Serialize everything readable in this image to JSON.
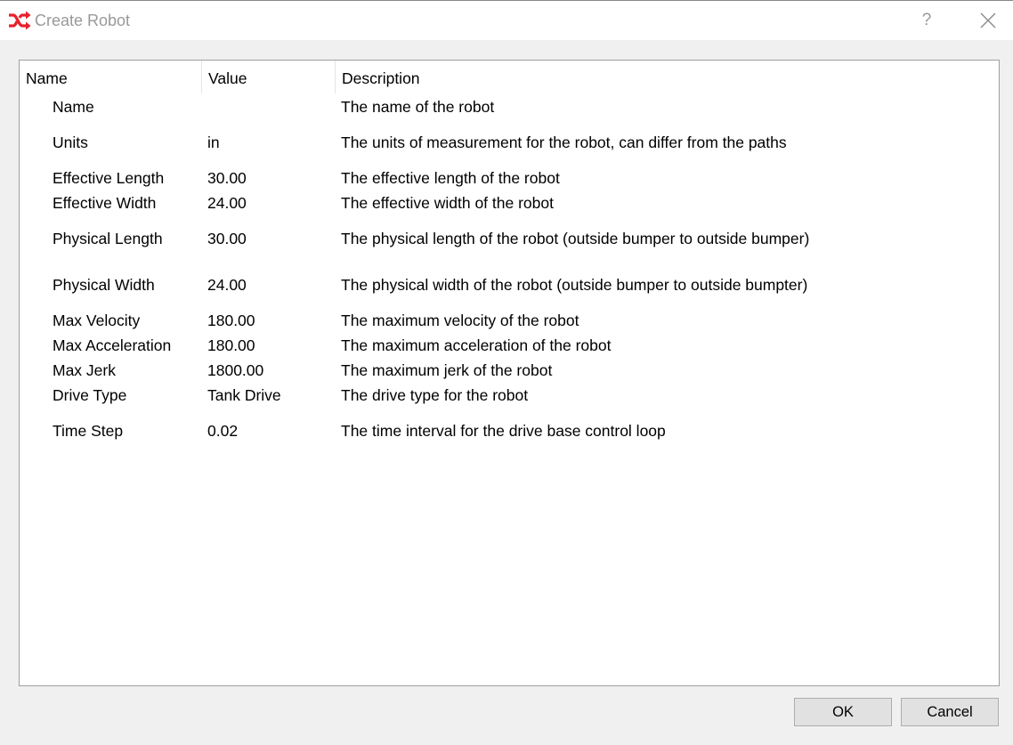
{
  "window": {
    "title": "Create Robot",
    "help_label": "?"
  },
  "table": {
    "headers": [
      "Name",
      "Value",
      "Description"
    ],
    "rows": [
      {
        "name": "Name",
        "value": "",
        "description": "The name of the robot"
      },
      {
        "name": "Units",
        "value": "in",
        "description": "The units of measurement for the robot, can differ from the paths"
      },
      {
        "name": "Effective Length",
        "value": "30.00",
        "description": "The effective length of the robot"
      },
      {
        "name": "Effective Width",
        "value": "24.00",
        "description": "The effective width of the robot"
      },
      {
        "name": "Physical Length",
        "value": "30.00",
        "description": "The physical length of the robot (outside bumper to outside bumper)"
      },
      {
        "name": "Physical Width",
        "value": "24.00",
        "description": "The physical width of the robot (outside bumper to outside bumpter)"
      },
      {
        "name": "Max Velocity",
        "value": "180.00",
        "description": "The maximum velocity of the robot"
      },
      {
        "name": "Max Acceleration",
        "value": "180.00",
        "description": "The maximum acceleration of the robot"
      },
      {
        "name": "Max Jerk",
        "value": "1800.00",
        "description": "The maximum jerk of the robot"
      },
      {
        "name": "Drive Type",
        "value": "Tank Drive",
        "description": "The drive type for the robot"
      },
      {
        "name": "Time Step",
        "value": "0.02",
        "description": "The time interval for the drive base control loop"
      }
    ]
  },
  "buttons": {
    "ok": "OK",
    "cancel": "Cancel"
  },
  "colors": {
    "app_icon": "#e8202a",
    "title_text": "#999999",
    "dialog_bg": "#f0f0f0",
    "button_bg": "#e1e1e1"
  },
  "icons": {
    "app": "shuffle-icon",
    "help": "question-mark-icon",
    "close": "close-icon"
  }
}
